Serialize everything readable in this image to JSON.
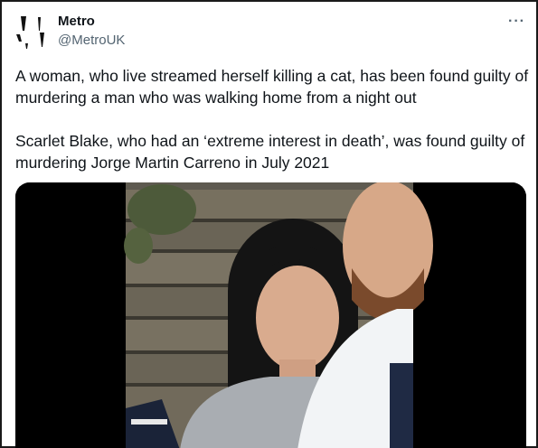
{
  "tweet": {
    "author_name": "Metro",
    "author_handle": "@MetroUK",
    "more_icon": "more-horizontal-icon",
    "paragraphs": [
      "A woman, who live streamed herself killing a cat, has been found guilty of murdering a man who was walking home from a night out",
      "Scarlet Blake, who had an ‘extreme interest in death’, was found guilty of murdering Jorge Martin Carreno in July 2021"
    ]
  },
  "colors": {
    "text": "#0f1419",
    "muted": "#536471",
    "media_background": "#000000",
    "fence": "#6f6a5e"
  }
}
